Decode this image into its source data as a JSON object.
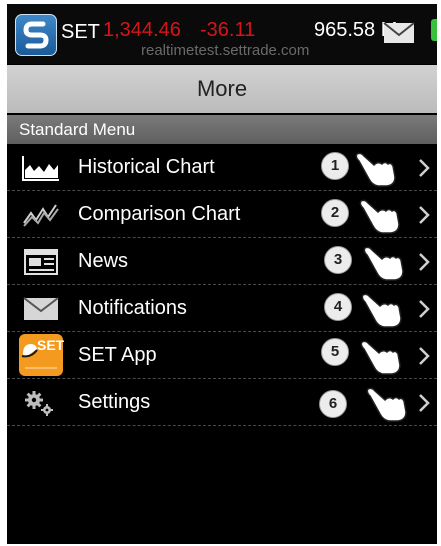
{
  "status_bar": {
    "index_name": "SET",
    "index_value": "1,344.46",
    "index_change": "-36.11",
    "volume": "965.58 M",
    "server": "realtimetest.settrade.com"
  },
  "header": {
    "title": "More"
  },
  "section": {
    "title": "Standard Menu"
  },
  "menu": {
    "items": [
      {
        "label": "Historical Chart",
        "icon": "historical-chart-icon",
        "step": "1"
      },
      {
        "label": "Comparison Chart",
        "icon": "comparison-chart-icon",
        "step": "2"
      },
      {
        "label": "News",
        "icon": "news-icon",
        "step": "3"
      },
      {
        "label": "Notifications",
        "icon": "mail-icon",
        "step": "4"
      },
      {
        "label": "SET App",
        "icon": "set-app-icon",
        "step": "5",
        "logo_text": "SET"
      },
      {
        "label": "Settings",
        "icon": "gear-icon",
        "step": "6"
      }
    ]
  },
  "colors": {
    "negative": "#d4151b",
    "header_bg": "#c8c8c8",
    "section_bg": "#6b6b6b",
    "set_app_orange": "#f39a1f"
  }
}
